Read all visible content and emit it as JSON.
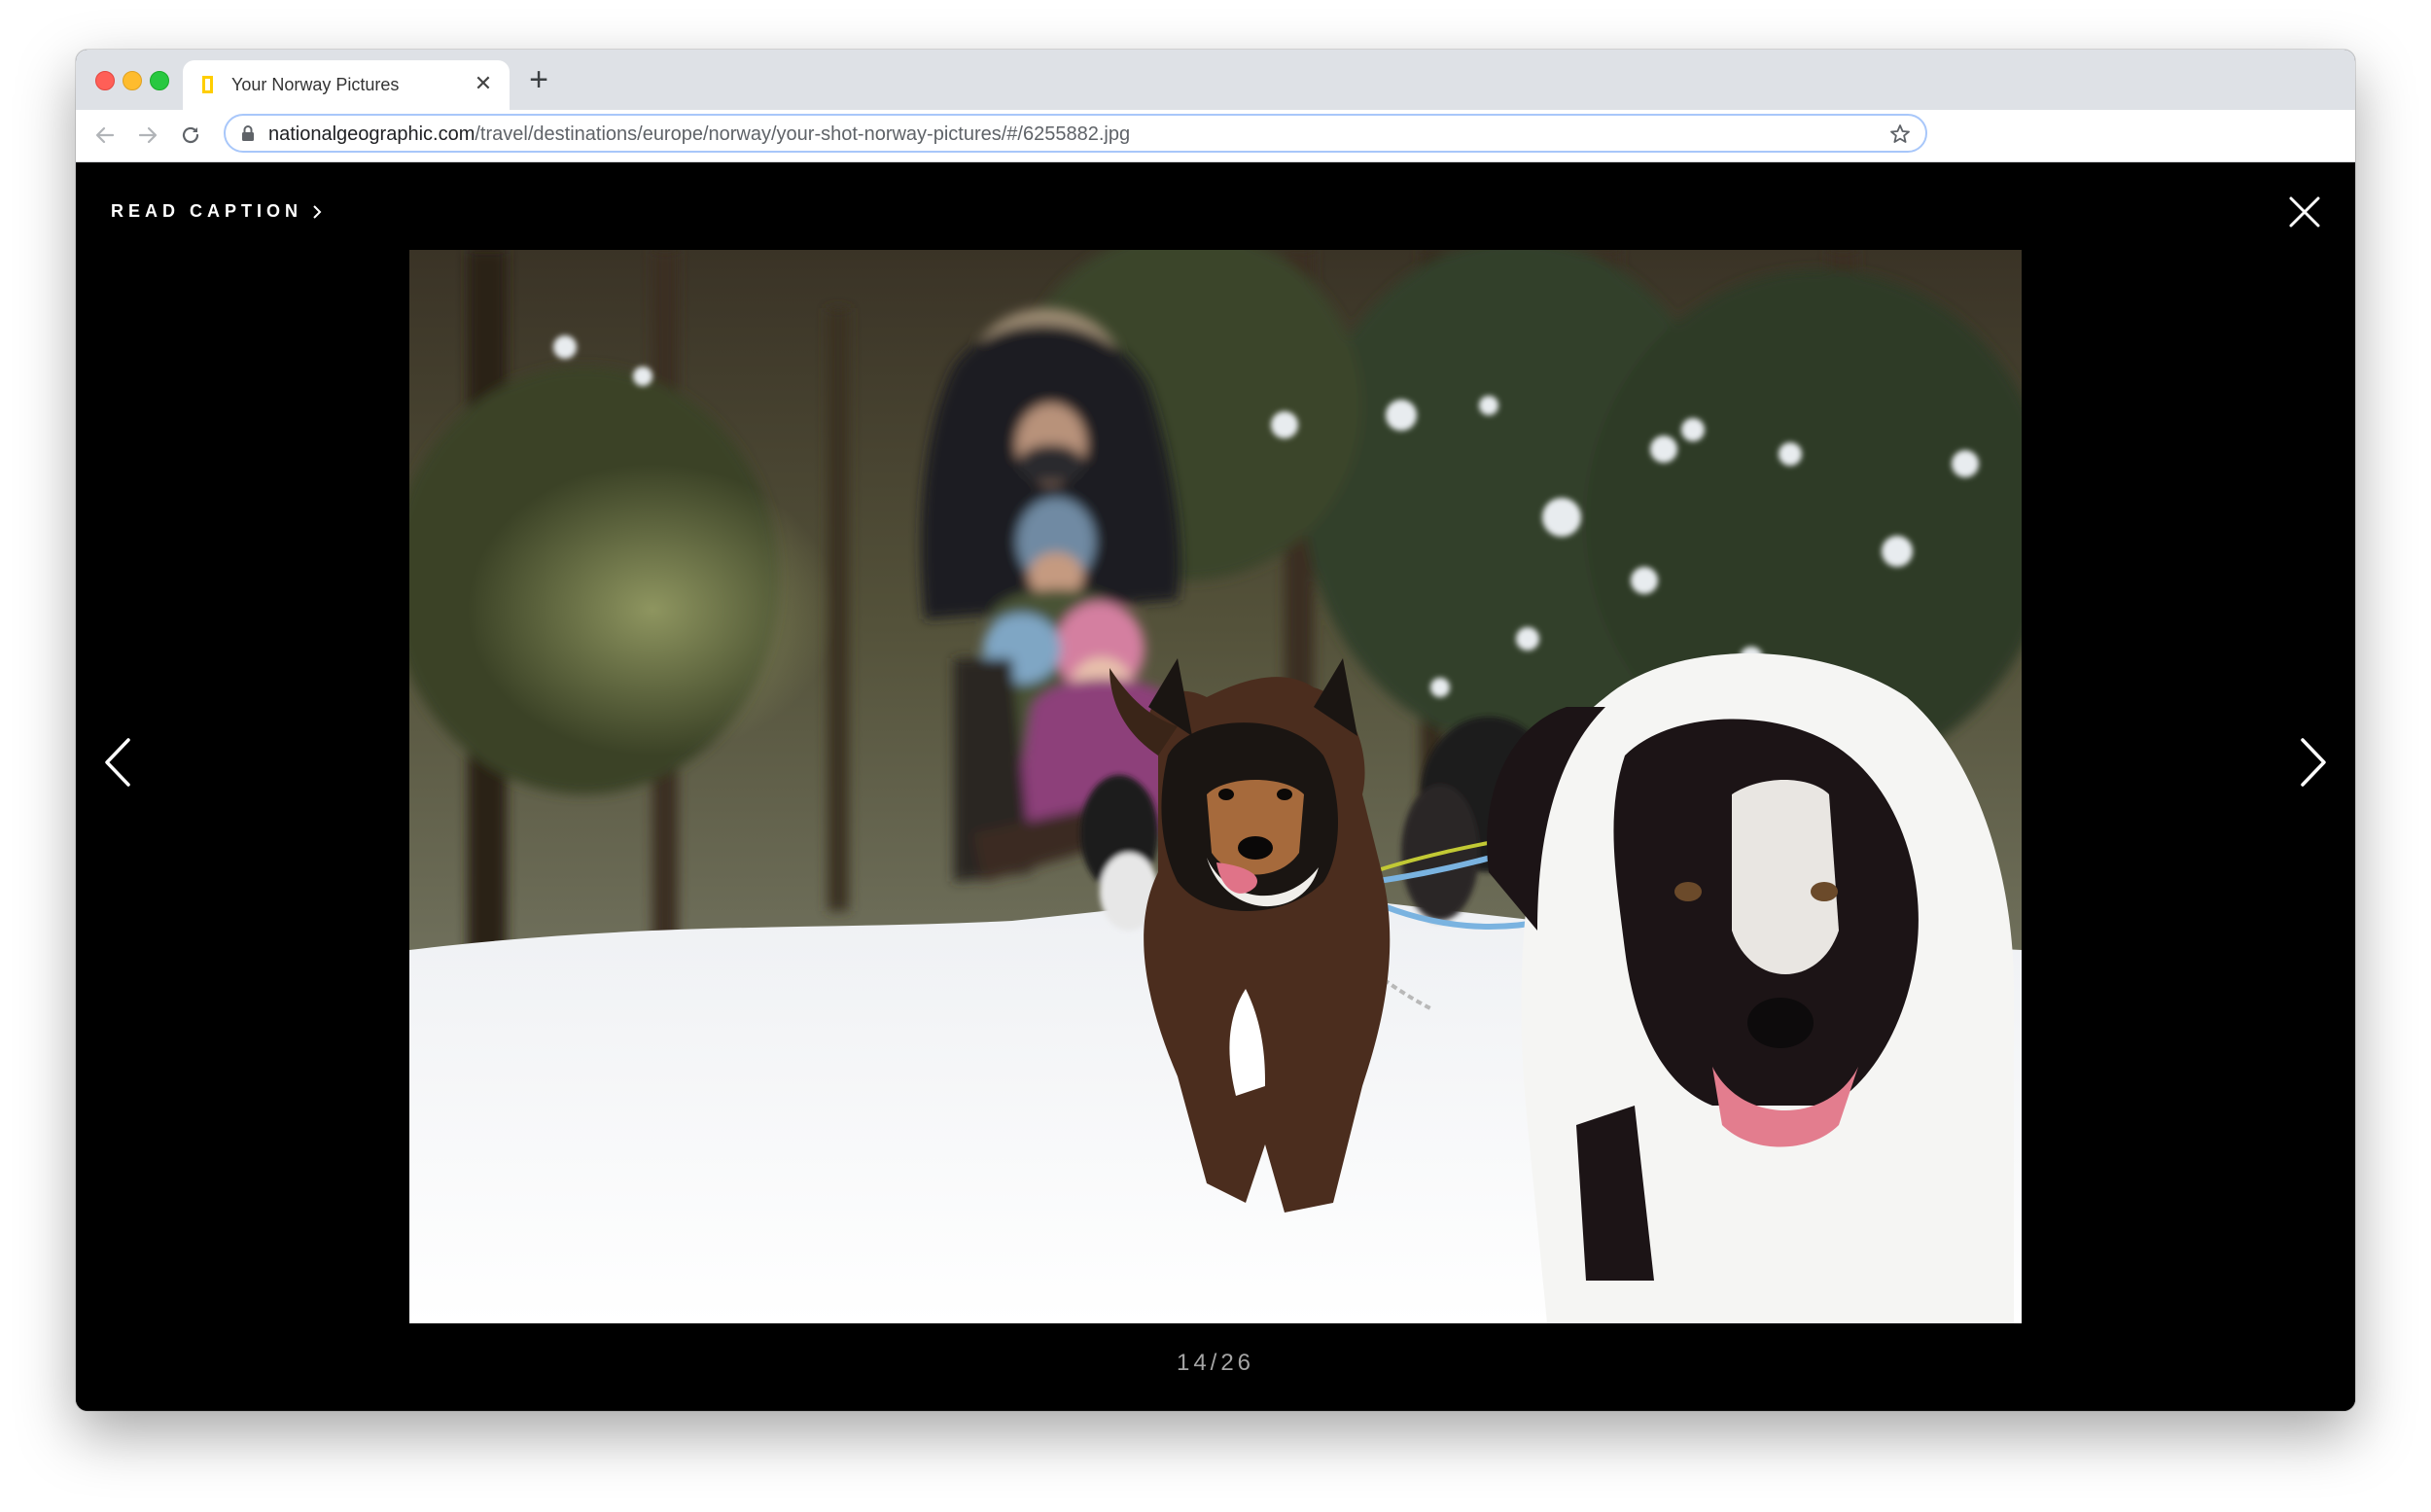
{
  "browser": {
    "tab_title": "Your Norway Pictures",
    "tab_close_icon": "close-icon",
    "new_tab_icon": "plus-icon",
    "url_domain": "nationalgeographic.com",
    "url_path": "/travel/destinations/europe/norway/your-shot-norway-pictures/#/6255882.jpg"
  },
  "viewer": {
    "read_caption": "READ CAPTION",
    "counter": "14/26",
    "icons": {
      "caption_chevron": "chevron-right-icon",
      "close": "close-icon",
      "prev": "chevron-left-icon",
      "next": "chevron-right-icon"
    },
    "photo": {
      "subject": "dog sled team in snowy forest"
    }
  },
  "colors": {
    "viewer_background": "#000000",
    "tabstrip": "#dee1e6",
    "omnibox_focus": "#a8c7fa",
    "favicon": "#ffce00"
  }
}
